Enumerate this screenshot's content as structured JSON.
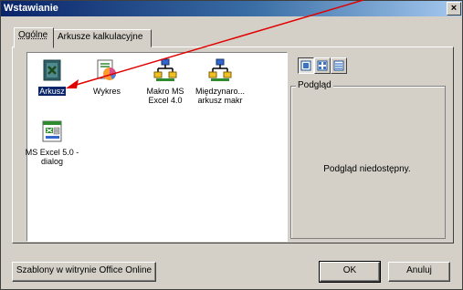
{
  "dialog": {
    "title": "Wstawianie",
    "close_label": "×"
  },
  "tabs": [
    {
      "label": "Ogólne",
      "active": true
    },
    {
      "label": "Arkusze kalkulacyjne",
      "active": false
    }
  ],
  "items": [
    {
      "label_line1": "Arkusz",
      "label_line2": "",
      "icon": "worksheet-icon",
      "selected": true
    },
    {
      "label_line1": "Wykres",
      "label_line2": "",
      "icon": "chart-icon",
      "selected": false
    },
    {
      "label_line1": "Makro MS",
      "label_line2": "Excel 4.0",
      "icon": "macro-sheet-icon",
      "selected": false
    },
    {
      "label_line1": "Międzynaro...",
      "label_line2": "arkusz makr",
      "icon": "international-macro-icon",
      "selected": false
    },
    {
      "label_line1": "MS Excel 5.0 -",
      "label_line2": "dialog",
      "icon": "dialog-sheet-icon",
      "selected": false
    }
  ],
  "view_buttons": [
    "large-icons-view-icon",
    "list-view-icon",
    "details-view-icon"
  ],
  "preview": {
    "legend": "Podgląd",
    "message": "Podgląd niedostępny."
  },
  "buttons": {
    "online": "Szablony w witrynie Office Online",
    "ok": "OK",
    "cancel": "Anuluj"
  },
  "colors": {
    "titlebar_start": "#0a246a",
    "face": "#d4d0c8",
    "selection": "#0a246a",
    "annotation_arrow": "#e00000"
  }
}
